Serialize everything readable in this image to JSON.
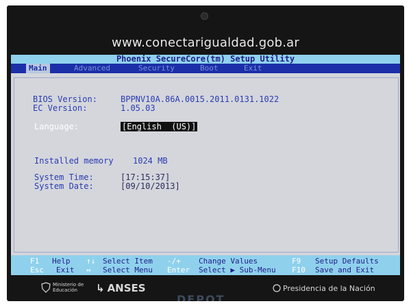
{
  "banner": {
    "url": "www.conectarigualdad.gob.ar"
  },
  "bios": {
    "title": "Phoenix SecureCore(tm) Setup Utility",
    "tabs": [
      "Main",
      "Advanced",
      "Security",
      "Boot",
      "Exit"
    ],
    "active_tab": "Main",
    "fields": {
      "bios_version_label": "BIOS Version:",
      "bios_version_value": "BPPNV10A.86A.0015.2011.0131.1022",
      "ec_version_label": "EC Version:",
      "ec_version_value": "1.05.03",
      "language_label": "Language:",
      "language_value": "[English  (US)]",
      "installed_memory_label": "Installed memory",
      "installed_memory_value": "1024 MB",
      "system_time_label": "System Time:",
      "system_time_value": "[17:15:37]",
      "system_date_label": "System Date:",
      "system_date_value": "[09/10/2013]"
    },
    "footer": {
      "row1": [
        {
          "key": "F1",
          "desc": "Help"
        },
        {
          "key": "↑↓",
          "desc": "Select Item"
        },
        {
          "key": "-/+",
          "desc": "Change Values"
        },
        {
          "key": "F9",
          "desc": "Setup Defaults"
        }
      ],
      "row2": [
        {
          "key": "Esc",
          "desc": "Exit"
        },
        {
          "key": "↔",
          "desc": "Select Menu"
        },
        {
          "key": "Enter",
          "desc": "Select ▶ Sub-Menu"
        },
        {
          "key": "F10",
          "desc": "Save and Exit"
        }
      ]
    }
  },
  "bezel": {
    "ministerio_line1": "Ministerio de",
    "ministerio_line2": "Educación",
    "anses": "ANSES",
    "presidencia": "Presidencia de la Nación",
    "brand": "DEPOT"
  }
}
